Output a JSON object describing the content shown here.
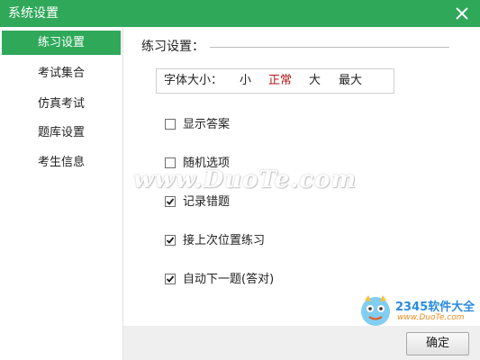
{
  "window": {
    "title": "系统设置",
    "accent_color": "#2fa85a"
  },
  "sidebar": {
    "items": [
      {
        "label": "练习设置",
        "active": true
      },
      {
        "label": "考试集合",
        "active": false
      },
      {
        "label": "仿真考试",
        "active": false
      },
      {
        "label": "题库设置",
        "active": false
      },
      {
        "label": "考生信息",
        "active": false
      }
    ]
  },
  "main": {
    "section_title": "练习设置：",
    "font_size": {
      "label": "字体大小：",
      "options": [
        "小",
        "正常",
        "大",
        "最大"
      ],
      "selected": "正常",
      "selected_color": "#b0171c"
    },
    "options": [
      {
        "label": "显示答案",
        "checked": false
      },
      {
        "label": "随机选项",
        "checked": false
      },
      {
        "label": "记录错题",
        "checked": true
      },
      {
        "label": "接上次位置练习",
        "checked": true
      },
      {
        "label": "自动下一题(答对)",
        "checked": true
      }
    ]
  },
  "footer": {
    "ok_label": "确定"
  },
  "watermark": {
    "text": "www.DuoTe.com",
    "logo_brand": "2345软件大全",
    "logo_url": "www.DuoTe.com"
  }
}
